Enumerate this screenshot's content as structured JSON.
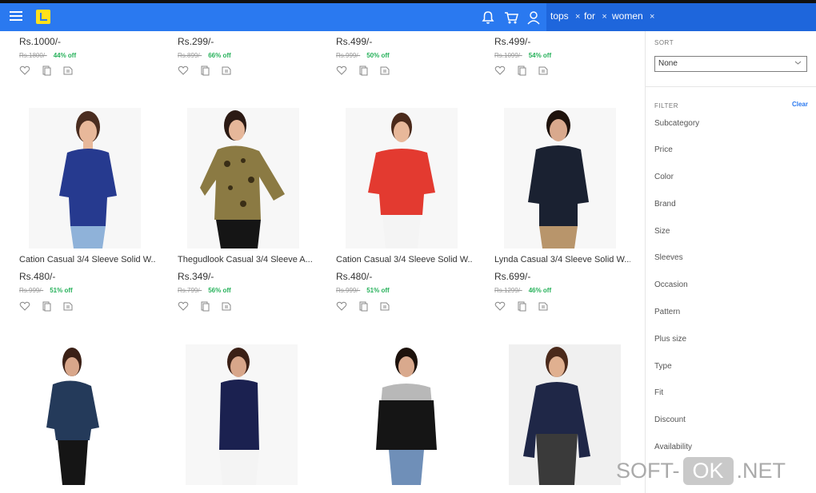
{
  "header": {
    "menu_icon": "hamburger-icon",
    "logo_icon": "flipkart-logo",
    "icons": [
      "bell-icon",
      "cart-icon",
      "user-icon"
    ],
    "tags": [
      "tops",
      "for",
      "women"
    ],
    "tag_remove": "×"
  },
  "sidebar": {
    "sort_label": "SORT",
    "sort_value": "None",
    "filter_label": "FILTER",
    "clear": "Clear",
    "filters": [
      "Subcategory",
      "Price",
      "Color",
      "Brand",
      "Size",
      "Sleeves",
      "Occasion",
      "Pattern",
      "Plus size",
      "Type",
      "Fit",
      "Discount",
      "Availability"
    ]
  },
  "products": {
    "row1": [
      {
        "price": "Rs.1000/-",
        "old": "Rs.1800/-",
        "off": "44% off"
      },
      {
        "price": "Rs.299/-",
        "old": "Rs.899/-",
        "off": "66% off"
      },
      {
        "price": "Rs.499/-",
        "old": "Rs.999/-",
        "off": "50% off"
      },
      {
        "price": "Rs.499/-",
        "old": "Rs.1099/-",
        "off": "54% off"
      }
    ],
    "row2": [
      {
        "title": "Cation Casual 3/4 Sleeve Solid W...",
        "price": "Rs.480/-",
        "old": "Rs.999/-",
        "off": "51% off"
      },
      {
        "title": "Thegudlook Casual 3/4 Sleeve A...",
        "price": "Rs.349/-",
        "old": "Rs.799/-",
        "off": "56% off"
      },
      {
        "title": "Cation Casual 3/4 Sleeve Solid W...",
        "price": "Rs.480/-",
        "old": "Rs.999/-",
        "off": "51% off"
      },
      {
        "title": "Lynda Casual 3/4 Sleeve Solid W...",
        "price": "Rs.699/-",
        "old": "Rs.1299/-",
        "off": "46% off"
      }
    ]
  },
  "watermark": {
    "left": "SOFT-",
    "middle": "OK",
    "right": ".NET"
  }
}
